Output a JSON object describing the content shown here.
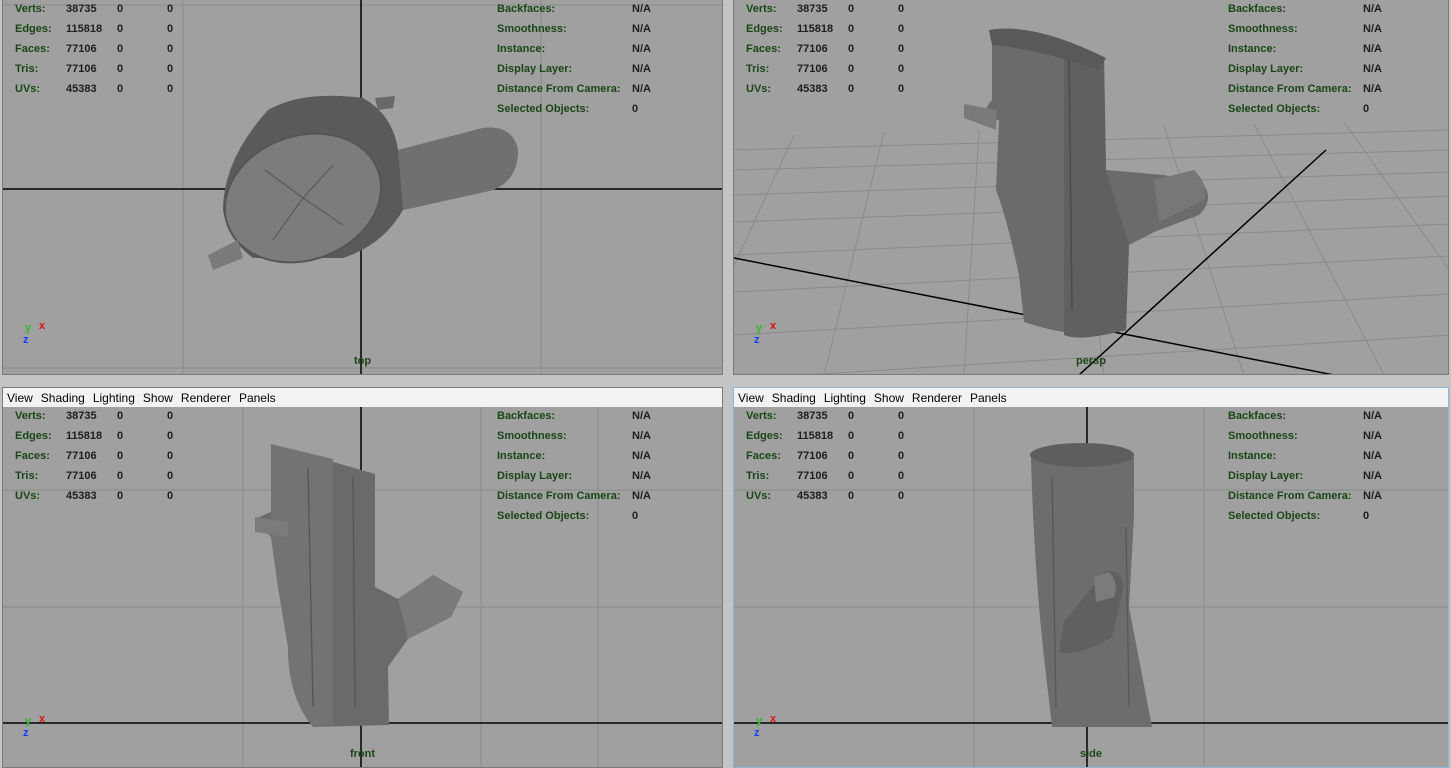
{
  "menu": [
    "View",
    "Shading",
    "Lighting",
    "Show",
    "Renderer",
    "Panels"
  ],
  "stats": {
    "rows": [
      {
        "label": "Verts:",
        "v1": "38735",
        "v2": "0",
        "v3": "0"
      },
      {
        "label": "Edges:",
        "v1": "115818",
        "v2": "0",
        "v3": "0"
      },
      {
        "label": "Faces:",
        "v1": "77106",
        "v2": "0",
        "v3": "0"
      },
      {
        "label": "Tris:",
        "v1": "77106",
        "v2": "0",
        "v3": "0"
      },
      {
        "label": "UVs:",
        "v1": "45383",
        "v2": "0",
        "v3": "0"
      }
    ]
  },
  "info": {
    "rows": [
      {
        "label": "Backfaces:",
        "value": "N/A"
      },
      {
        "label": "Smoothness:",
        "value": "N/A"
      },
      {
        "label": "Instance:",
        "value": "N/A"
      },
      {
        "label": "Display Layer:",
        "value": "N/A"
      },
      {
        "label": "Distance From Camera:",
        "value": "N/A"
      },
      {
        "label": "Selected Objects:",
        "value": "0"
      }
    ]
  },
  "axis": {
    "x": "x",
    "y": "y",
    "z": "z"
  },
  "colors": {
    "hud_green": "#1a4616",
    "viewport_bg": "#a0a0a0",
    "mesh": "#6a6a6a"
  },
  "panels": {
    "top": {
      "camera": "top"
    },
    "persp": {
      "camera": "persp"
    },
    "front": {
      "camera": "front"
    },
    "side": {
      "camera": "side"
    }
  }
}
